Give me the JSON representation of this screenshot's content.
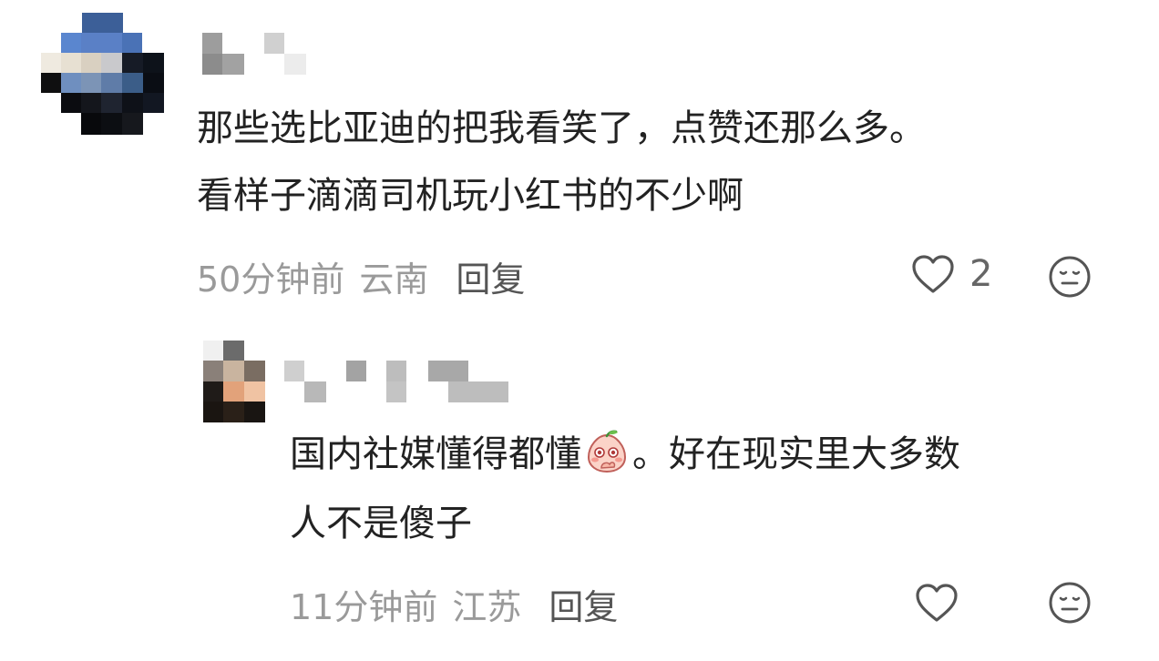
{
  "comments": [
    {
      "text_line1": "那些选比亚迪的把我看笑了，点赞还那么多。",
      "text_line2": "看样子滴滴司机玩小红书的不少啊",
      "time": "50分钟前",
      "location": "云南",
      "reply_label": "回复",
      "like_count": "2",
      "like_icon": "heart-outline-icon",
      "dislike_icon": "neutral-face-icon"
    },
    {
      "text_line1_before_emoji": "国内社媒懂得都懂",
      "emoji": "peach-emoji-icon",
      "text_line1_after_emoji": "。好在现实里大多数",
      "text_line2": "人不是傻子",
      "time": "11分钟前",
      "location": "江苏",
      "reply_label": "回复",
      "like_icon": "heart-outline-icon",
      "dislike_icon": "neutral-face-icon"
    }
  ]
}
